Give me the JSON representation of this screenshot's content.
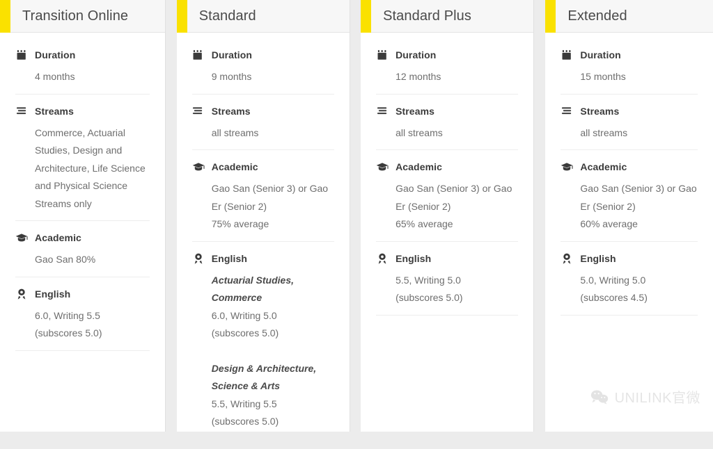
{
  "watermark": {
    "icon": "wechat-icon",
    "text": "UNILINK官微"
  },
  "columns": [
    {
      "title": "Transition Online",
      "accent": "#fae100",
      "features": [
        {
          "icon": "calendar-icon",
          "label": "Duration",
          "lines": [
            {
              "text": "4 months",
              "emphasis": false
            }
          ]
        },
        {
          "icon": "streams-icon",
          "label": "Streams",
          "lines": [
            {
              "text": "Commerce, Actuarial",
              "emphasis": false
            },
            {
              "text": "Studies, Design and",
              "emphasis": false
            },
            {
              "text": "Architecture, Life Science",
              "emphasis": false
            },
            {
              "text": "and Physical Science",
              "emphasis": false
            },
            {
              "text": "Streams only",
              "emphasis": false
            }
          ]
        },
        {
          "icon": "graduation-cap-icon",
          "label": "Academic",
          "lines": [
            {
              "text": "Gao San 80%",
              "emphasis": false
            }
          ]
        },
        {
          "icon": "medal-icon",
          "label": "English",
          "lines": [
            {
              "text": "6.0, Writing 5.5",
              "emphasis": false
            },
            {
              "text": "(subscores 5.0)",
              "emphasis": false
            }
          ]
        }
      ]
    },
    {
      "title": "Standard",
      "accent": "#fae100",
      "features": [
        {
          "icon": "calendar-icon",
          "label": "Duration",
          "lines": [
            {
              "text": "9 months",
              "emphasis": false
            }
          ]
        },
        {
          "icon": "streams-icon",
          "label": "Streams",
          "lines": [
            {
              "text": "all streams",
              "emphasis": false
            }
          ]
        },
        {
          "icon": "graduation-cap-icon",
          "label": "Academic",
          "lines": [
            {
              "text": "Gao San (Senior 3) or Gao",
              "emphasis": false
            },
            {
              "text": "Er (Senior 2)",
              "emphasis": false
            },
            {
              "text": "75% average",
              "emphasis": false
            }
          ]
        },
        {
          "icon": "medal-icon",
          "label": "English",
          "lines": [
            {
              "text": "Actuarial Studies,",
              "emphasis": true
            },
            {
              "text": "Commerce",
              "emphasis": true
            },
            {
              "text": "6.0, Writing 5.0",
              "emphasis": false
            },
            {
              "text": "(subscores 5.0)",
              "emphasis": false
            },
            {
              "text": "Design & Architecture,",
              "emphasis": true,
              "gap_above": true
            },
            {
              "text": "Science & Arts",
              "emphasis": true
            },
            {
              "text": "5.5, Writing 5.5",
              "emphasis": false
            },
            {
              "text": "(subscores 5.0)",
              "emphasis": false
            }
          ]
        }
      ]
    },
    {
      "title": "Standard Plus",
      "accent": "#fae100",
      "features": [
        {
          "icon": "calendar-icon",
          "label": "Duration",
          "lines": [
            {
              "text": "12 months",
              "emphasis": false
            }
          ]
        },
        {
          "icon": "streams-icon",
          "label": "Streams",
          "lines": [
            {
              "text": "all streams",
              "emphasis": false
            }
          ]
        },
        {
          "icon": "graduation-cap-icon",
          "label": "Academic",
          "lines": [
            {
              "text": "Gao San (Senior 3) or Gao",
              "emphasis": false
            },
            {
              "text": "Er (Senior 2)",
              "emphasis": false
            },
            {
              "text": "65% average",
              "emphasis": false
            }
          ]
        },
        {
          "icon": "medal-icon",
          "label": "English",
          "lines": [
            {
              "text": "5.5, Writing 5.0",
              "emphasis": false
            },
            {
              "text": "(subscores 5.0)",
              "emphasis": false
            }
          ]
        }
      ]
    },
    {
      "title": "Extended",
      "accent": "#fae100",
      "features": [
        {
          "icon": "calendar-icon",
          "label": "Duration",
          "lines": [
            {
              "text": "15 months",
              "emphasis": false
            }
          ]
        },
        {
          "icon": "streams-icon",
          "label": "Streams",
          "lines": [
            {
              "text": "all streams",
              "emphasis": false
            }
          ]
        },
        {
          "icon": "graduation-cap-icon",
          "label": "Academic",
          "lines": [
            {
              "text": "Gao San (Senior 3) or Gao",
              "emphasis": false
            },
            {
              "text": "Er (Senior 2)",
              "emphasis": false
            },
            {
              "text": "60% average",
              "emphasis": false
            }
          ]
        },
        {
          "icon": "medal-icon",
          "label": "English",
          "lines": [
            {
              "text": "5.0, Writing 5.0",
              "emphasis": false
            },
            {
              "text": "(subscores 4.5)",
              "emphasis": false
            }
          ]
        }
      ]
    }
  ]
}
